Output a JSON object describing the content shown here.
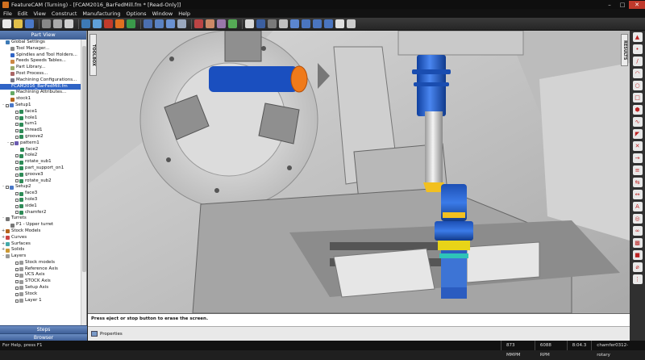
{
  "window": {
    "title": "FeatureCAM (Turning) - [FCAM2016_BarFedMill.fm * [Read-Only]]"
  },
  "menu": [
    "File",
    "Edit",
    "View",
    "Construct",
    "Manufacturing",
    "Options",
    "Window",
    "Help"
  ],
  "left_panel": {
    "title": "Part View",
    "items": [
      {
        "label": "Global Settings",
        "level": 0,
        "icon": "globe-icon"
      },
      {
        "label": "Tool Manager...",
        "level": 1,
        "icon": "tool-icon"
      },
      {
        "label": "Spindles and Tool Holders...",
        "level": 1,
        "icon": "spindle-icon"
      },
      {
        "label": "Feeds  Speeds Tables...",
        "level": 1,
        "icon": "table-icon"
      },
      {
        "label": "Part Library...",
        "level": 1,
        "icon": "library-icon"
      },
      {
        "label": "Post Process...",
        "level": 1,
        "icon": "post-icon"
      },
      {
        "label": "Machining Configurations...",
        "level": 1,
        "icon": "config-icon"
      },
      {
        "label": "FCAM2016_BarFedMill.fm",
        "level": 0,
        "icon": "file-icon",
        "selected": true
      },
      {
        "label": "Machining Attributes...",
        "level": 1,
        "icon": "attr-icon"
      },
      {
        "label": "stock1",
        "level": 1,
        "icon": "stock-icon"
      },
      {
        "label": "Setup1",
        "level": 0,
        "icon": "setup-icon",
        "expand": "-",
        "check": true
      },
      {
        "label": "face1",
        "level": 2,
        "icon": "feature-icon",
        "check": true
      },
      {
        "label": "hole1",
        "level": 2,
        "icon": "feature-icon",
        "check": true
      },
      {
        "label": "turn1",
        "level": 2,
        "icon": "feature-icon",
        "check": true
      },
      {
        "label": "thread1",
        "level": 2,
        "icon": "feature-icon",
        "check": true
      },
      {
        "label": "groove2",
        "level": 2,
        "icon": "feature-icon",
        "check": true
      },
      {
        "label": "pattern1",
        "level": 1,
        "icon": "pattern-icon",
        "expand": "-",
        "check": true
      },
      {
        "label": "face2",
        "level": 3,
        "icon": "feature-icon"
      },
      {
        "label": "hole2",
        "level": 2,
        "icon": "feature-icon",
        "check": true
      },
      {
        "label": "rotate_sub1",
        "level": 2,
        "icon": "feature-icon",
        "check": true
      },
      {
        "label": "part_support_on1",
        "level": 2,
        "icon": "feature-icon",
        "check": true
      },
      {
        "label": "groove3",
        "level": 2,
        "icon": "feature-icon",
        "check": true
      },
      {
        "label": "rotate_sub2",
        "level": 2,
        "icon": "feature-icon",
        "check": true
      },
      {
        "label": "Setup2",
        "level": 0,
        "icon": "setup-icon",
        "expand": "-",
        "check": true
      },
      {
        "label": "face3",
        "level": 2,
        "icon": "feature-icon",
        "check": true
      },
      {
        "label": "hole3",
        "level": 2,
        "icon": "feature-icon",
        "check": true
      },
      {
        "label": "side1",
        "level": 2,
        "icon": "feature-icon",
        "check": true
      },
      {
        "label": "chamfer2",
        "level": 2,
        "icon": "feature-icon",
        "check": true
      },
      {
        "label": "Turrets",
        "level": 0,
        "icon": "turret-icon",
        "expand": "-"
      },
      {
        "label": "P1 - Upper turret",
        "level": 1,
        "icon": "turret-icon"
      },
      {
        "label": "Stock Models",
        "level": 0,
        "icon": "stock-icon",
        "expand": "+"
      },
      {
        "label": "Curves",
        "level": 0,
        "icon": "curve-icon",
        "expand": "+"
      },
      {
        "label": "Surfaces",
        "level": 0,
        "icon": "surface-icon",
        "expand": "+"
      },
      {
        "label": "Solids",
        "level": 0,
        "icon": "solid-icon",
        "expand": "+"
      },
      {
        "label": "Layers",
        "level": 0,
        "icon": "layer-icon",
        "expand": "-"
      },
      {
        "label": "Stock models",
        "level": 2,
        "icon": "layer-icon",
        "check": true
      },
      {
        "label": "Reference Axis",
        "level": 2,
        "icon": "layer-icon",
        "check": true
      },
      {
        "label": "UCS Axis",
        "level": 2,
        "icon": "layer-icon",
        "check": true
      },
      {
        "label": "STOCK Axis",
        "level": 2,
        "icon": "layer-icon",
        "check": true
      },
      {
        "label": "Setup Axis",
        "level": 2,
        "icon": "layer-icon",
        "check": true
      },
      {
        "label": "Stock",
        "level": 2,
        "icon": "layer-icon",
        "check": true
      },
      {
        "label": "Layer 1",
        "level": 2,
        "icon": "layer-icon",
        "check": true
      }
    ],
    "tabs": [
      "Steps",
      "Browser"
    ]
  },
  "viewport": {
    "toolbox_label": "TOOLBOX",
    "results_label": "RESULTS"
  },
  "message": "Press eject or stop button to erase the screen.",
  "properties_label": "Properties",
  "status": {
    "help": "For Help, press F1",
    "mmpm": "873 MMPM",
    "rpm": "6088 RPM",
    "time": "8:04.3",
    "op": "chamfer0312-rotary"
  },
  "colors": {
    "accent": "#2f64c6",
    "stock": "#f07a1a",
    "tool": "#1e56c8"
  }
}
